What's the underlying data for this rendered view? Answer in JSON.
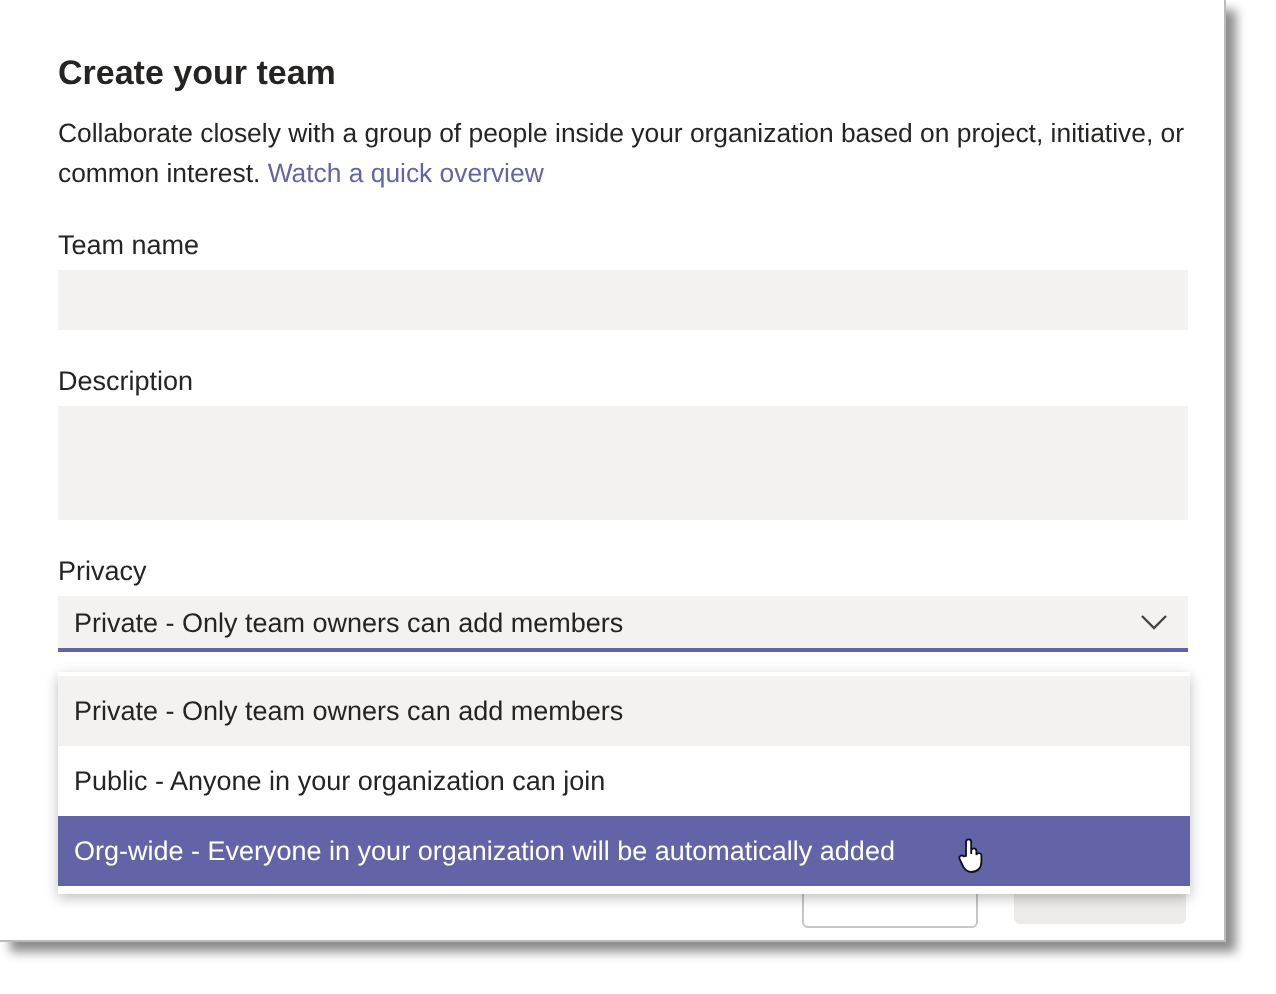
{
  "dialog": {
    "title": "Create your team",
    "description": "Collaborate closely with a group of people inside your organization based on project, initiative, or common interest.",
    "link": "Watch a quick overview"
  },
  "fields": [
    {
      "label": "Team name",
      "kind": "single"
    },
    {
      "label": "Description",
      "kind": "multi"
    }
  ],
  "privacy": {
    "label": "Privacy",
    "value": "Private - Only team owners can add members",
    "expanded": true,
    "options": [
      {
        "label": "Private - Only team owners can add members",
        "selected": true,
        "hovered": false
      },
      {
        "label": "Public - Anyone in your organization can join",
        "selected": false,
        "hovered": false
      },
      {
        "label": "Org-wide - Everyone in your organization will be automatically added",
        "selected": false,
        "hovered": true
      }
    ]
  }
}
